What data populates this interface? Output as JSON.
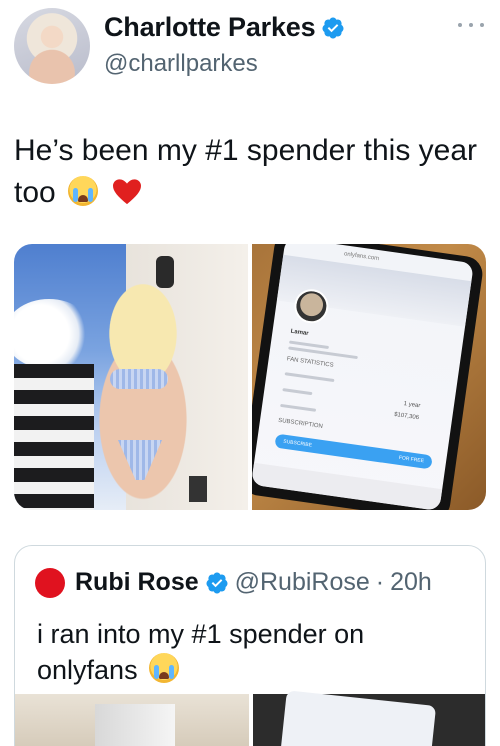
{
  "tweet": {
    "author": {
      "display_name": "Charlotte Parkes",
      "handle": "@charllparkes",
      "verified": true
    },
    "text": "He’s been my #1 spender this year too",
    "emojis": [
      "loudly-crying-face",
      "red-heart"
    ],
    "media": [
      {
        "kind": "photo",
        "description_icon": "photo-icon"
      },
      {
        "kind": "photo",
        "description_icon": "photo-icon"
      }
    ]
  },
  "phone_screen": {
    "url": "onlyfans.com",
    "name": "Lamar",
    "fan_statistics": "FAN STATISTICS",
    "subscribed_for": "1 year",
    "spent": "$107,306",
    "subscription": "SUBSCRIPTION",
    "subscribe_button": "SUBSCRIBE",
    "for_free": "FOR FREE"
  },
  "quote": {
    "author": {
      "display_name": "Rubi Rose",
      "handle": "@RubiRose",
      "separator": "·",
      "time": "20h",
      "verified": true
    },
    "text": "i ran into my #1 spender on onlyfans",
    "emoji": "loudly-crying-face"
  },
  "colors": {
    "verified_blue": "#1d9bf0",
    "text_primary": "#0f1419",
    "text_secondary": "#536471",
    "border": "#cfd9de"
  }
}
